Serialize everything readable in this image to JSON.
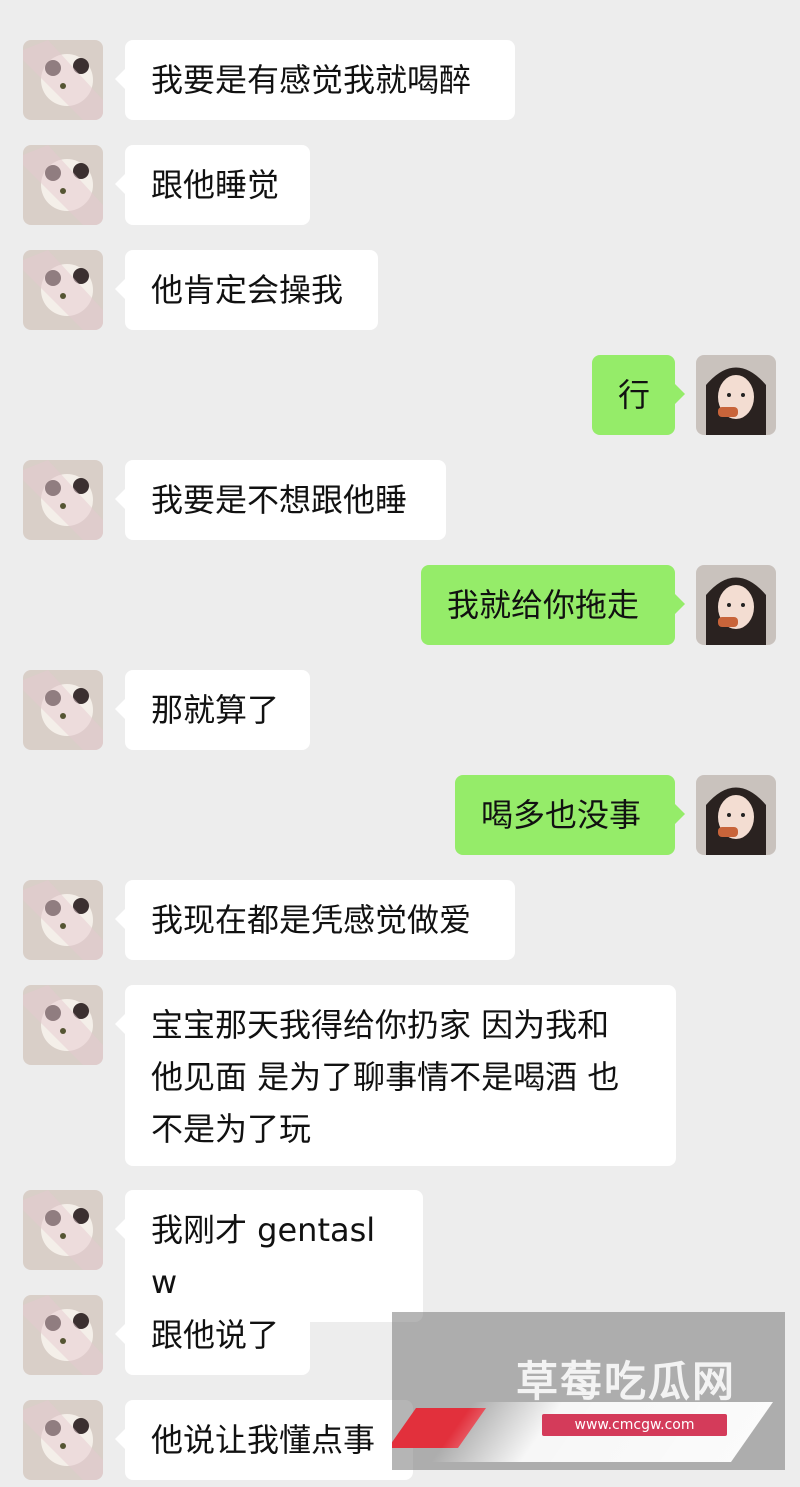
{
  "messages": [
    {
      "side": "left",
      "text": "我要是有感觉我就喝醉"
    },
    {
      "side": "left",
      "text": "跟他睡觉"
    },
    {
      "side": "left",
      "text": "他肯定会操我"
    },
    {
      "side": "right",
      "text": "行"
    },
    {
      "side": "left",
      "text": "我要是不想跟他睡"
    },
    {
      "side": "right",
      "text": "我就给你拖走"
    },
    {
      "side": "left",
      "text": "那就算了"
    },
    {
      "side": "right",
      "text": "喝多也没事"
    },
    {
      "side": "left",
      "text": "我现在都是凭感觉做爱"
    },
    {
      "side": "left",
      "text": "宝宝那天我得给你扔家 因为我和\n他见面 是为了聊事情不是喝酒 也\n不是为了玩"
    },
    {
      "side": "left",
      "text": "我刚才 gentaslw"
    },
    {
      "side": "left",
      "text": "跟他说了"
    },
    {
      "side": "left",
      "text": "他说让我懂点事"
    }
  ],
  "watermark": {
    "title": "草莓吃瓜网",
    "url": "www.cmcgw.com"
  },
  "colors": {
    "background": "#ededed",
    "incoming_bubble": "#ffffff",
    "outgoing_bubble": "#95ec69",
    "text": "#111111"
  },
  "icons": {
    "left_avatar": "plush-toy-avatar-icon",
    "right_avatar": "girl-photo-avatar-icon"
  }
}
